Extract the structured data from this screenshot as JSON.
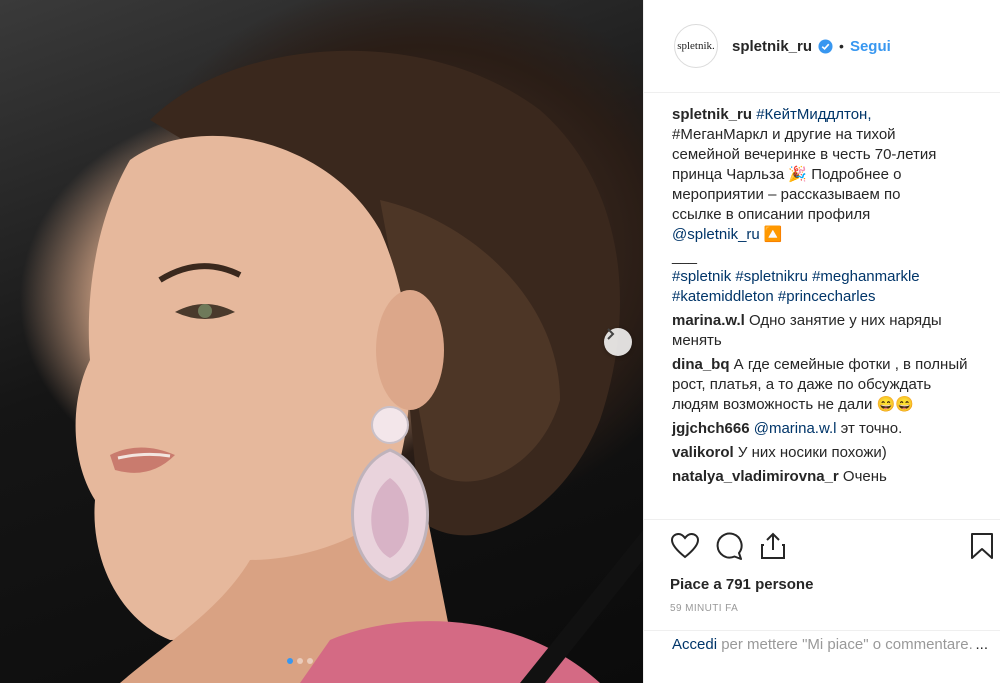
{
  "post": {
    "slide_count": 3,
    "active_slide": 1
  },
  "header": {
    "avatar_text": "spletnik.",
    "username": "spletnik_ru",
    "separator": "•",
    "follow_label": "Segui"
  },
  "caption": {
    "author": "spletnik_ru",
    "lines": [
      "#КейтМиддлтон,",
      "#МеганМаркл и другие на тихой",
      "семейной вечеринке в честь 70-летия",
      "принца Чарльза 🎉 Подробнее о",
      "мероприятии – рассказываем по",
      "ссылке в описании профиля",
      "@spletnik_ru 🔼"
    ],
    "divider": "___",
    "tags_line1": "#spletnik #spletnikru #meghanmarkle",
    "tags_line2": "#katemiddleton #princecharles"
  },
  "comments": [
    {
      "user": "marina.w.l",
      "text": " Одно занятие у них наряды менять"
    },
    {
      "user": "dina_bq",
      "text": " А где семейные фотки , в полный рост, платья, а то даже по обсуждать людям возможность не дали 😄😄"
    },
    {
      "user": "jgjchch666",
      "mention": "@marina.w.l",
      "text": " эт точно."
    },
    {
      "user": "valikorol",
      "text": " У них носики похожи)"
    },
    {
      "user": "natalya_vladimirovna_r",
      "text": " Очень"
    }
  ],
  "footer": {
    "likes": "Piace a 791 persone",
    "time": "59 MINUTI FA",
    "login_link": "Accedi",
    "login_text": " per mettere \"Mi piace\" o commentare.",
    "more": "..."
  },
  "colors": {
    "accent": "#3897f0",
    "link": "#003569",
    "text": "#262626",
    "muted": "#999999",
    "border": "#efefef"
  },
  "icons": [
    "chevron-right-icon",
    "verified-badge-icon",
    "heart-icon",
    "comment-icon",
    "share-icon",
    "bookmark-icon"
  ]
}
